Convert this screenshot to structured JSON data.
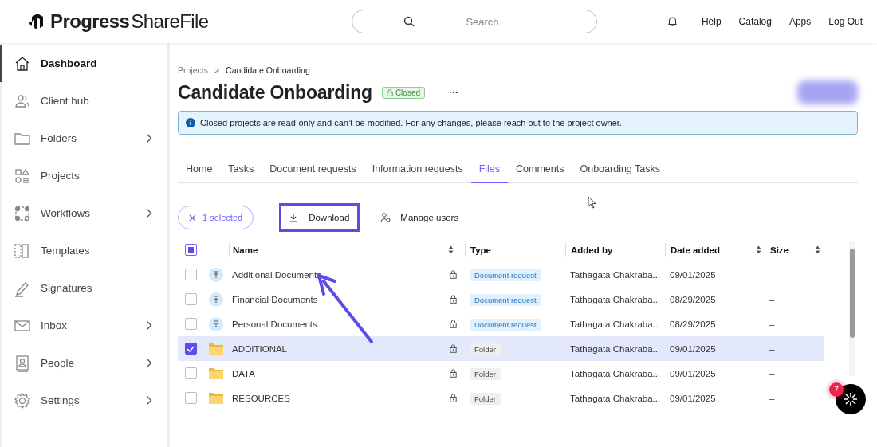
{
  "header": {
    "logo": "Progress",
    "logo_product": "ShareFile",
    "search": {
      "placeholder": "Search"
    },
    "links": [
      "Help",
      "Catalog",
      "Apps",
      "Log Out"
    ]
  },
  "sidebar": {
    "items": [
      {
        "label": "Dashboard",
        "selected": true,
        "expandable": false
      },
      {
        "label": "Client hub",
        "selected": false,
        "expandable": false
      },
      {
        "label": "Folders",
        "selected": false,
        "expandable": true
      },
      {
        "label": "Projects",
        "selected": false,
        "expandable": false
      },
      {
        "label": "Workflows",
        "selected": false,
        "expandable": true
      },
      {
        "label": "Templates",
        "selected": false,
        "expandable": false
      },
      {
        "label": "Signatures",
        "selected": false,
        "expandable": false
      },
      {
        "label": "Inbox",
        "selected": false,
        "expandable": true
      },
      {
        "label": "People",
        "selected": false,
        "expandable": true
      },
      {
        "label": "Settings",
        "selected": false,
        "expandable": true
      }
    ]
  },
  "breadcrumb": [
    "Projects",
    "Candidate Onboarding"
  ],
  "breadcrumb_separator": ">",
  "title": "Candidate Onboarding",
  "status_badge": "Closed",
  "more": "···",
  "notice": "Closed projects are read-only and can’t be modified. For any changes, please reach out to the project owner.",
  "tabs": [
    {
      "label": "Home",
      "selected": false
    },
    {
      "label": "Tasks",
      "selected": false
    },
    {
      "label": "Document requests",
      "selected": false
    },
    {
      "label": "Information requests",
      "selected": false
    },
    {
      "label": "Files",
      "selected": true
    },
    {
      "label": "Comments",
      "selected": false
    },
    {
      "label": "Onboarding Tasks",
      "selected": false
    }
  ],
  "toolbar": {
    "selection": "1 selected",
    "download": "Download",
    "manage": "Manage users"
  },
  "table": {
    "columns": [
      "Name",
      "Type",
      "Added by",
      "Date added",
      "Size"
    ],
    "select_all_partial": true,
    "rows": [
      {
        "kind": "request",
        "name": "Additional Documents",
        "type": "Document request",
        "added_by": "Tathagata Chakraba...",
        "date": "09/01/2025",
        "size": "–",
        "selected": false
      },
      {
        "kind": "request",
        "name": "Financial Documents",
        "type": "Document request",
        "added_by": "Tathagata Chakraba...",
        "date": "08/29/2025",
        "size": "–",
        "selected": false
      },
      {
        "kind": "request",
        "name": "Personal Documents",
        "type": "Document request",
        "added_by": "Tathagata Chakraba...",
        "date": "08/29/2025",
        "size": "–",
        "selected": false
      },
      {
        "kind": "folder",
        "name": "ADDITIONAL",
        "type": "Folder",
        "added_by": "Tathagata Chakraba...",
        "date": "09/01/2025",
        "size": "–",
        "selected": true
      },
      {
        "kind": "folder",
        "name": "DATA",
        "type": "Folder",
        "added_by": "Tathagata Chakraba...",
        "date": "09/01/2025",
        "size": "–",
        "selected": false
      },
      {
        "kind": "folder",
        "name": "RESOURCES",
        "type": "Folder",
        "added_by": "Tathagata Chakraba...",
        "date": "09/01/2025",
        "size": "–",
        "selected": false
      }
    ]
  },
  "chat": {
    "badge": "7"
  }
}
